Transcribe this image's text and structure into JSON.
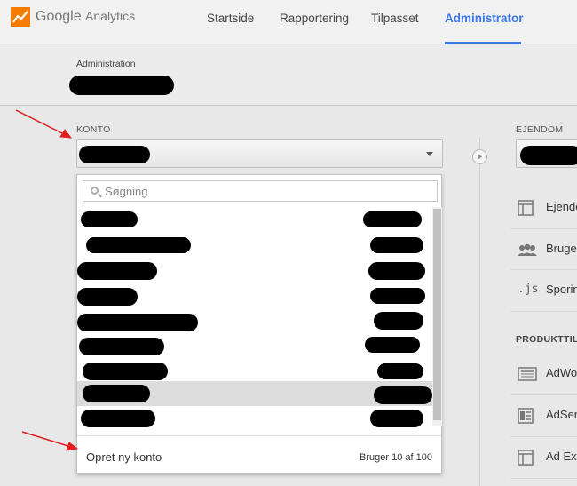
{
  "logo": {
    "google": "Google",
    "product": "Analytics"
  },
  "nav": {
    "items": [
      {
        "label": "Startside",
        "active": false
      },
      {
        "label": "Rapportering",
        "active": false
      },
      {
        "label": "Tilpasset",
        "active": false
      },
      {
        "label": "Administrator",
        "active": true
      }
    ],
    "accent": "#3b78e7"
  },
  "admin": {
    "label": "Administration"
  },
  "account": {
    "section_label": "KONTO",
    "search_placeholder": "Søgning",
    "create_label": "Opret ny konto",
    "count_text": "Bruger 10 af 100"
  },
  "property": {
    "section_label": "EJENDOM",
    "items": [
      {
        "label": "Ejendo",
        "icon": "window-icon"
      },
      {
        "label": "Bruge",
        "icon": "users-icon"
      },
      {
        "label": "Sporin",
        "icon": "js-icon",
        "icon_text": ".js"
      }
    ],
    "sub_label": "PRODUKTTIL",
    "product_items": [
      {
        "label": "AdWo",
        "icon": "adwords-icon"
      },
      {
        "label": "AdSer",
        "icon": "adsense-icon"
      },
      {
        "label": "Ad Ex",
        "icon": "window-icon"
      }
    ]
  },
  "annotation_color": "#e02020"
}
